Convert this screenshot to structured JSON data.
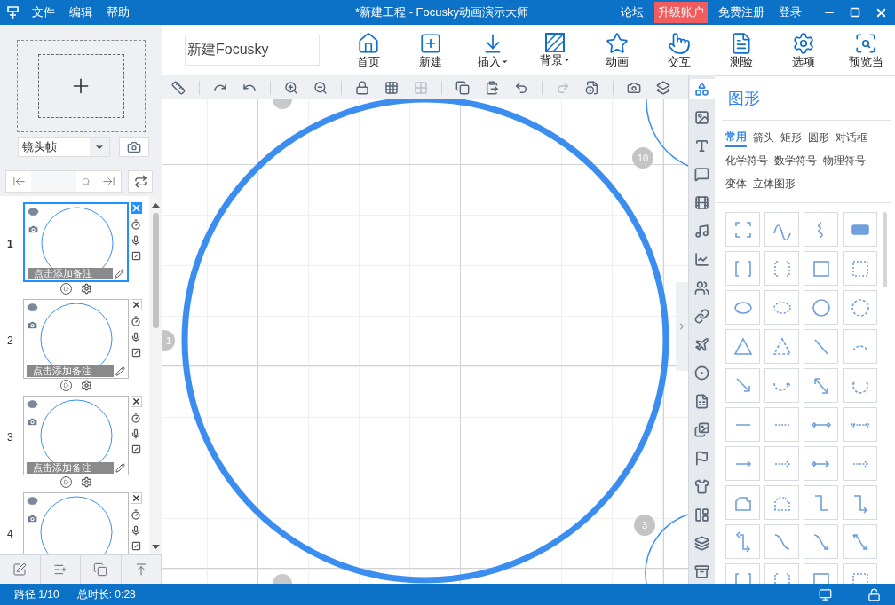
{
  "menu": [
    "文件",
    "编辑",
    "帮助"
  ],
  "window": {
    "title": "*新建工程 - Focusky动画演示大师"
  },
  "account_links": [
    {
      "label": "论坛",
      "kind": "link"
    },
    {
      "label": "升级账户",
      "kind": "highlight"
    },
    {
      "label": "免费注册",
      "kind": "link"
    },
    {
      "label": "登录",
      "kind": "link"
    }
  ],
  "project_name": {
    "value": "新建Focusky"
  },
  "main_toolbar": [
    {
      "label": "首页",
      "has_menu": false
    },
    {
      "label": "新建",
      "has_menu": false
    },
    {
      "label": "插入",
      "has_menu": true
    },
    {
      "label": "背景",
      "has_menu": true
    },
    {
      "label": "动画",
      "has_menu": false
    },
    {
      "label": "交互",
      "has_menu": false
    },
    {
      "label": "测验",
      "has_menu": false
    },
    {
      "label": "选项",
      "has_menu": false
    },
    {
      "label": "预览当",
      "has_menu": false
    }
  ],
  "edit_toolbar": [
    {
      "disabled": false
    },
    {
      "disabled": false
    },
    {
      "disabled": false
    },
    {
      "disabled": false
    },
    {
      "disabled": false
    },
    {
      "disabled": false
    },
    {
      "disabled": false
    },
    {
      "disabled": true
    },
    {
      "disabled": false
    },
    {
      "disabled": false
    },
    {
      "disabled": false
    },
    {
      "disabled": true
    },
    {
      "disabled": false
    },
    {
      "disabled": false
    },
    {
      "disabled": false
    }
  ],
  "frame_type": {
    "value": "镜头帧"
  },
  "slides": [
    {
      "number": "1",
      "note": "点击添加备注",
      "selected": true
    },
    {
      "number": "2",
      "note": "点击添加备注",
      "selected": false
    },
    {
      "number": "3",
      "note": "点击添加备注",
      "selected": false
    },
    {
      "number": "4",
      "selected": false
    }
  ],
  "canvas_badges": [
    {
      "label": "1"
    },
    {
      "label": "10"
    },
    {
      "label": "3"
    }
  ],
  "side_tabs": [
    {
      "selected": true
    },
    {
      "selected": false
    },
    {
      "selected": false
    },
    {
      "selected": false
    },
    {
      "selected": false
    },
    {
      "selected": false
    },
    {
      "selected": false
    },
    {
      "selected": false
    },
    {
      "selected": false
    },
    {
      "selected": false
    },
    {
      "selected": false
    },
    {
      "selected": false
    },
    {
      "selected": false
    },
    {
      "selected": false
    },
    {
      "selected": false
    },
    {
      "selected": false
    },
    {
      "selected": false
    },
    {
      "selected": false
    }
  ],
  "panel": {
    "title": "图形",
    "categories": [
      {
        "label": "常用",
        "selected": true
      },
      {
        "label": "箭头",
        "selected": false
      },
      {
        "label": "矩形",
        "selected": false
      },
      {
        "label": "圆形",
        "selected": false
      },
      {
        "label": "对话框",
        "selected": false
      },
      {
        "label": "化学符号",
        "selected": false
      },
      {
        "label": "数学符号",
        "selected": false
      },
      {
        "label": "物理符号",
        "selected": false
      },
      {
        "label": "变体",
        "selected": false
      },
      {
        "label": "立体图形",
        "selected": false
      }
    ]
  },
  "status_bar": {
    "path": "路径 1/10",
    "duration": "总时长: 0:28"
  }
}
